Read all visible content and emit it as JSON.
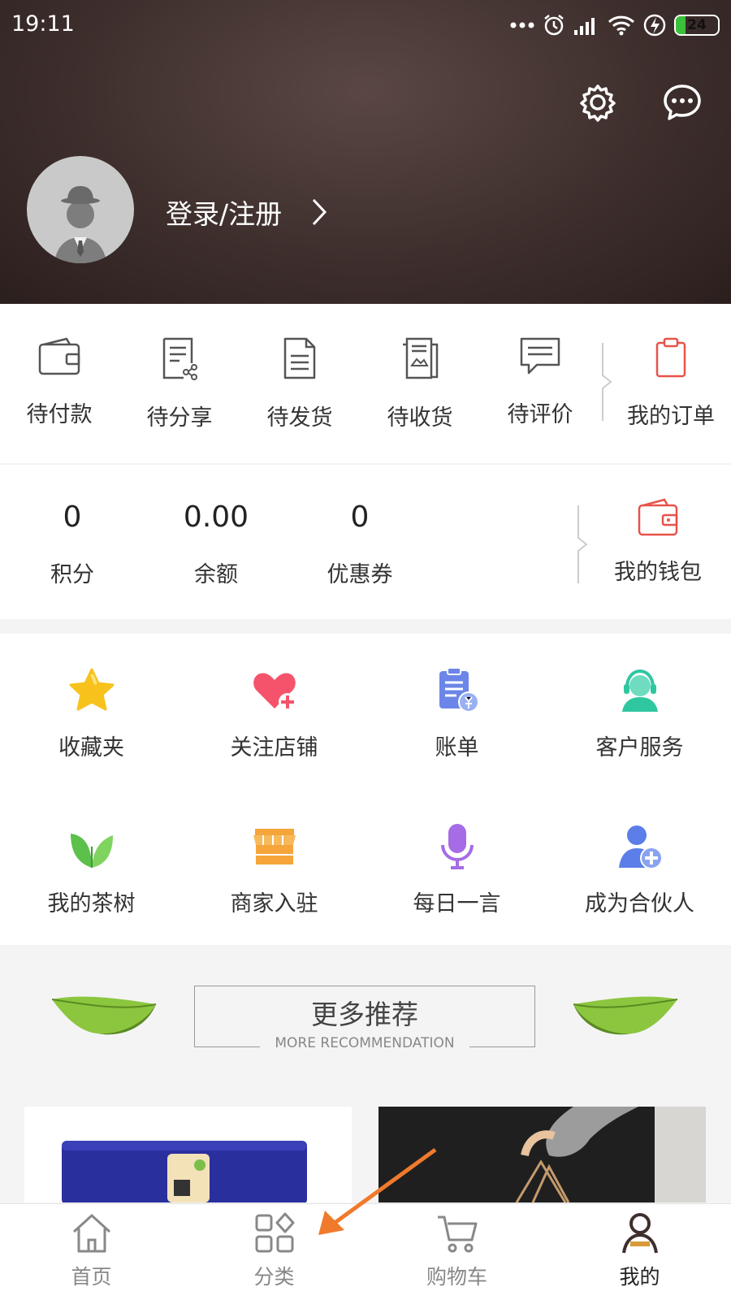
{
  "status_bar": {
    "time": "19:11",
    "battery": "24",
    "battery_level": 0.24
  },
  "header": {
    "login_text": "登录/注册",
    "settings_icon": "gear-icon",
    "message_icon": "chat-bubble-icon"
  },
  "orders": {
    "items": [
      {
        "label": "待付款",
        "icon": "wallet-icon"
      },
      {
        "label": "待分享",
        "icon": "share-document-icon"
      },
      {
        "label": "待发货",
        "icon": "document-icon"
      },
      {
        "label": "待收货",
        "icon": "receipt-icon"
      },
      {
        "label": "待评价",
        "icon": "comment-icon"
      }
    ],
    "all_orders": {
      "label": "我的订单",
      "icon": "clipboard-icon",
      "color": "#e8534a"
    }
  },
  "wallet": {
    "items": [
      {
        "value": "0",
        "label": "积分"
      },
      {
        "value": "0.00",
        "label": "余额"
      },
      {
        "value": "0",
        "label": "优惠券"
      }
    ],
    "my_wallet": {
      "label": "我的钱包",
      "icon": "wallet-icon",
      "color": "#e8534a"
    }
  },
  "services": [
    {
      "label": "收藏夹",
      "icon": "star-icon",
      "color": "#f7c21b"
    },
    {
      "label": "关注店铺",
      "icon": "heart-plus-icon",
      "color": "#f5536b"
    },
    {
      "label": "账单",
      "icon": "bill-icon",
      "color": "#6b86e8"
    },
    {
      "label": "客户服务",
      "icon": "headset-agent-icon",
      "color": "#2fc7a0"
    },
    {
      "label": "我的茶树",
      "icon": "leaf-sprout-icon",
      "color": "#5cc04a"
    },
    {
      "label": "商家入驻",
      "icon": "storefront-icon",
      "color": "#f5a53a"
    },
    {
      "label": "每日一言",
      "icon": "microphone-icon",
      "color": "#a56ce6"
    },
    {
      "label": "成为合伙人",
      "icon": "add-user-icon",
      "color": "#5b7ee8"
    }
  ],
  "recommend": {
    "title": "更多推荐",
    "subtitle": "MORE RECOMMENDATION"
  },
  "tabbar": {
    "items": [
      {
        "label": "首页",
        "icon": "home-icon"
      },
      {
        "label": "分类",
        "icon": "grid-category-icon"
      },
      {
        "label": "购物车",
        "icon": "cart-icon"
      },
      {
        "label": "我的",
        "icon": "user-icon"
      }
    ],
    "active_index": 3
  },
  "colors": {
    "header_bg": "#3e2f2d",
    "accent": "#e8534a",
    "annotation_arrow": "#f07a2c"
  }
}
